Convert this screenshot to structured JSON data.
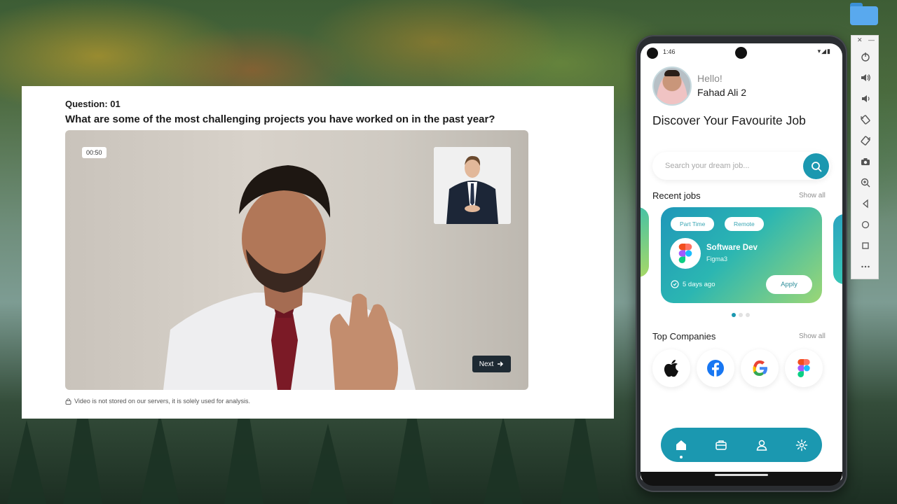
{
  "interview": {
    "question_label": "Question: 01",
    "question_text": "What are some of the most challenging projects you have worked on in the past year?",
    "timer": "00:50",
    "next_label": "Next",
    "disclaimer": "Video is not stored on our servers, it is solely used for analysis."
  },
  "phone": {
    "status_time": "1:46",
    "greeting": "Hello!",
    "user_name": "Fahad Ali 2",
    "headline": "Discover Your Favourite Job",
    "search_placeholder": "Search your dream job...",
    "recent_jobs_title": "Recent jobs",
    "recent_jobs_show_all": "Show all",
    "job_card": {
      "tags": [
        "Part Time",
        "Remote"
      ],
      "title": "Software Dev",
      "company": "Figma3",
      "posted": "5 days ago",
      "apply_label": "Apply"
    },
    "carousel_active_index": 0,
    "top_companies_title": "Top Companies",
    "top_companies_show_all": "Show all",
    "companies": [
      "apple-icon",
      "facebook-icon",
      "google-icon",
      "figma-icon"
    ],
    "nav": [
      "home-icon",
      "briefcase-icon",
      "profile-icon",
      "settings-icon"
    ],
    "accent_color": "#1b98b0"
  },
  "emulator_toolbar": {
    "buttons": [
      "power-icon",
      "volume-up-icon",
      "volume-down-icon",
      "rotate-left-icon",
      "rotate-right-icon",
      "camera-icon",
      "zoom-icon",
      "back-icon",
      "home-circle-icon",
      "overview-icon",
      "more-icon"
    ]
  }
}
